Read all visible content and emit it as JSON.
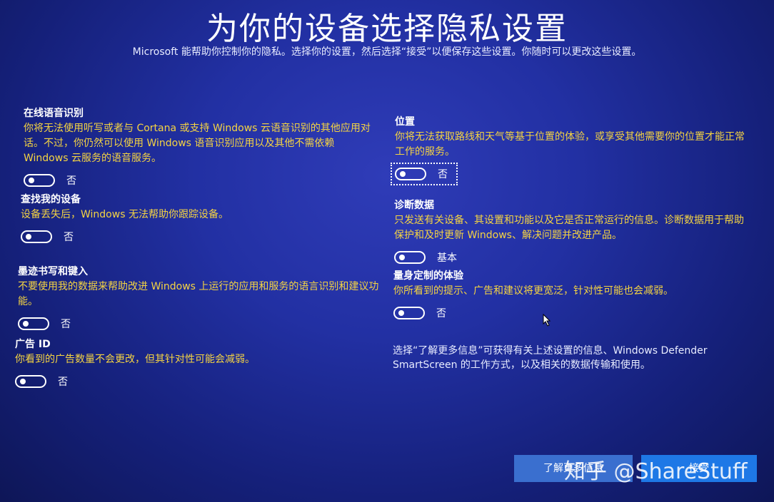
{
  "header": {
    "title": "为你的设备选择隐私设置",
    "subtitle": "Microsoft 能帮助你控制你的隐私。选择你的设置，然后选择“接受”以便保存这些设置。你随时可以更改这些设置。"
  },
  "left_settings": [
    {
      "title": "在线语音识别",
      "desc": "你将无法使用听写或者与 Cortana 或支持 Windows 云语音识别的其他应用对话。不过，你仍然可以使用 Windows 语音识别应用以及其他不需依赖 Windows 云服务的语音服务。",
      "state": "否"
    },
    {
      "title": "查找我的设备",
      "desc": "设备丢失后，Windows 无法帮助你跟踪设备。",
      "state": "否"
    },
    {
      "title": "墨迹书写和键入",
      "desc": "不要使用我的数据来帮助改进 Windows 上运行的应用和服务的语言识别和建议功能。",
      "state": "否"
    },
    {
      "title": "广告 ID",
      "desc": "你看到的广告数量不会更改，但其针对性可能会减弱。",
      "state": "否"
    }
  ],
  "right_settings": [
    {
      "title": "位置",
      "desc": "你将无法获取路线和天气等基于位置的体验，或享受其他需要你的位置才能正常工作的服务。",
      "state": "否"
    },
    {
      "title": "诊断数据",
      "desc": "只发送有关设备、其设置和功能以及它是否正常运行的信息。诊断数据用于帮助保护和及时更新 Windows、解决问题并改进产品。",
      "state": "基本"
    },
    {
      "title": "量身定制的体验",
      "desc": "你所看到的提示、广告和建议将更宽泛，针对性可能也会减弱。",
      "state": "否"
    }
  ],
  "info": {
    "text": "选择“了解更多信息”可获得有关上述设置的信息、Windows Defender SmartScreen 的工作方式，以及相关的数据传输和使用。"
  },
  "buttons": {
    "learn_more": "了解更多信息",
    "accept": "接受"
  },
  "watermark": "知乎 @ShareStuff",
  "colors": {
    "background": "#2230a3",
    "description_text": "#f5d442",
    "accept_button": "#1e78e6"
  }
}
